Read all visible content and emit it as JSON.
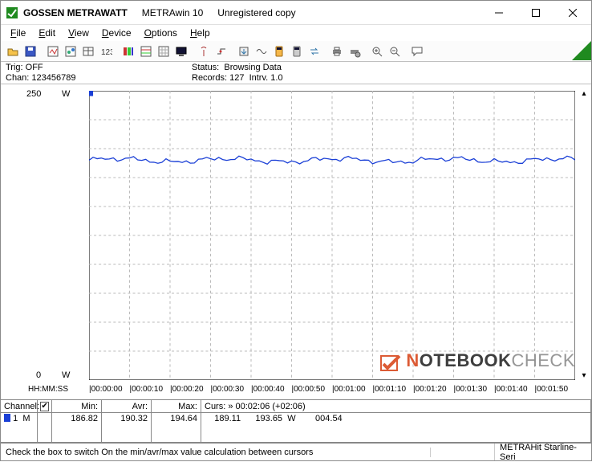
{
  "title": {
    "company": "GOSSEN METRAWATT",
    "product": "METRAwin 10",
    "license": "Unregistered copy"
  },
  "menu": {
    "file": "File",
    "edit": "Edit",
    "view": "View",
    "device": "Device",
    "options": "Options",
    "help": "Help"
  },
  "info": {
    "trig_label": "Trig:",
    "trig_value": "OFF",
    "chan_label": "Chan:",
    "chan_value": "123456789",
    "status_label": "Status:",
    "status_value": "Browsing Data",
    "records_label": "Records:",
    "records_value": "127",
    "intrv_label": "Intrv.",
    "intrv_value": "1.0"
  },
  "chart_axis": {
    "y_top": "250",
    "y_bot": "0",
    "unit": "W",
    "x_axis_label": "HH:MM:SS",
    "ticks": [
      "00:00:00",
      "00:00:10",
      "00:00:20",
      "00:00:30",
      "00:00:40",
      "00:00:50",
      "00:01:00",
      "00:01:10",
      "00:01:20",
      "00:01:30",
      "00:01:40",
      "00:01:50"
    ]
  },
  "chart_data": {
    "type": "line",
    "title": "",
    "xlabel": "HH:MM:SS",
    "ylabel": "W",
    "ylim": [
      0,
      250
    ],
    "x": [
      "00:00:00",
      "00:00:10",
      "00:00:20",
      "00:00:30",
      "00:00:40",
      "00:00:50",
      "00:01:00",
      "00:01:10",
      "00:01:20",
      "00:01:30",
      "00:01:40",
      "00:01:50",
      "00:02:00"
    ],
    "series": [
      {
        "name": "Channel 1 (W)",
        "color": "#1a3fd6",
        "values": [
          190,
          191,
          189,
          190,
          192,
          190,
          191,
          189,
          190,
          191,
          190,
          192,
          190
        ]
      }
    ]
  },
  "channel_table": {
    "head": {
      "channel": "Channel:",
      "min": "Min:",
      "avr": "Avr:",
      "max": "Max:",
      "curs": "Curs: » 00:02:06 (+02:06)"
    },
    "row": {
      "ch": "1",
      "letter": "M",
      "min": "186.82",
      "avr": "190.32",
      "max": "194.64",
      "cur1": "189.11",
      "cur2": "193.65",
      "unit": "W",
      "delta": "004.54",
      "color": "#1a3fd6",
      "checked": true
    }
  },
  "statusbar": {
    "hint": "Check the box to switch On the min/avr/max value calculation between cursors",
    "device": "METRAHit Starline-Seri"
  },
  "watermark": {
    "pfx": "N",
    "mid": "OTEBOOK",
    "sfx": "CHECK"
  }
}
